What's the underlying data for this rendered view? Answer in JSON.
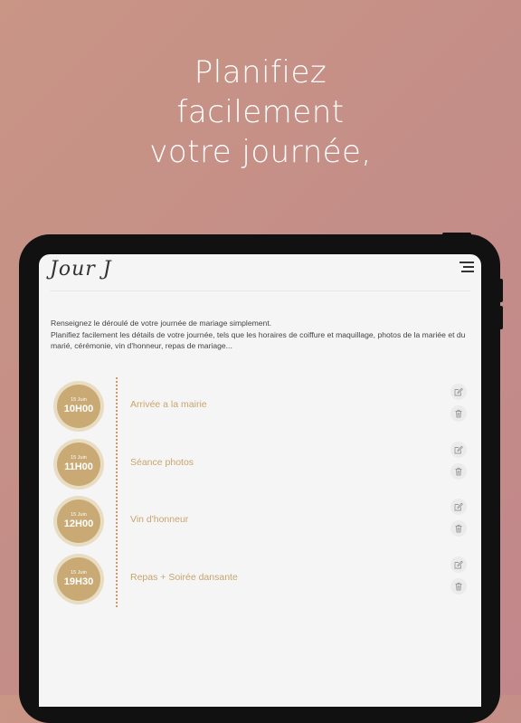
{
  "headline": {
    "line1": "Planifiez",
    "line2": "facilement",
    "line3": "votre journée,"
  },
  "app": {
    "logo": "Jour J",
    "menu_icon": "hamburger-menu-icon"
  },
  "intro": {
    "line1": "Renseignez le déroulé de votre journée de mariage simplement.",
    "line2": "Planifiez facilement les détails de votre journée, tels que les horaires de coiffure et maquillage, photos de la mariée et du marié, cérémonie, vin d'honneur, repas de mariage..."
  },
  "events": [
    {
      "day": "15 Juin",
      "time": "10H00",
      "title": "Arrivée a la mairie"
    },
    {
      "day": "15 Juin",
      "time": "11H00",
      "title": "Séance photos"
    },
    {
      "day": "15 Juin",
      "time": "12H00",
      "title": "Vin d'honneur"
    },
    {
      "day": "15 Juin",
      "time": "19H30",
      "title": "Repas + Soirée dansante"
    }
  ],
  "icons": {
    "edit": "edit-icon",
    "delete": "trash-icon"
  },
  "colors": {
    "background_gradient": [
      "#c99585",
      "#c2878b"
    ],
    "accent_gold": "#c9aa74",
    "title_gold": "#c9a56e",
    "timeline_dots": "#d49a5e"
  }
}
